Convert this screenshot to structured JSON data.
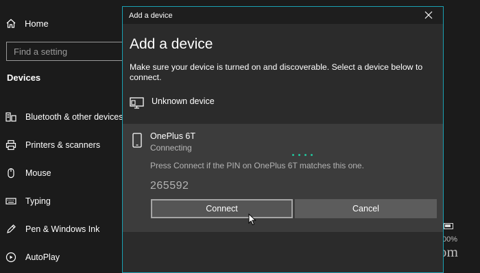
{
  "sidebar": {
    "home_label": "Home",
    "search_placeholder": "Find a setting",
    "section_title": "Devices",
    "items": [
      {
        "label": "Bluetooth & other devices",
        "icon": "bluetooth-devices-icon"
      },
      {
        "label": "Printers & scanners",
        "icon": "printer-icon"
      },
      {
        "label": "Mouse",
        "icon": "mouse-icon"
      },
      {
        "label": "Typing",
        "icon": "keyboard-icon"
      },
      {
        "label": "Pen & Windows Ink",
        "icon": "pen-icon"
      },
      {
        "label": "AutoPlay",
        "icon": "autoplay-icon"
      }
    ]
  },
  "background": {
    "battery_percent_fragment": "00%",
    "watermark": "groovyPost.com"
  },
  "dialog": {
    "window_title": "Add a device",
    "heading": "Add a device",
    "instructions": "Make sure your device is turned on and discoverable. Select a device below to connect.",
    "unknown_device": "Unknown device",
    "selected_device": {
      "name": "OnePlus 6T",
      "status": "Connecting",
      "pin_message": "Press Connect if the PIN on OnePlus 6T matches this one.",
      "pin": "265592"
    },
    "connect_label": "Connect",
    "cancel_label": "Cancel"
  },
  "colors": {
    "accent_border": "#1aa2b4",
    "progress_dots": "#23c29a"
  }
}
